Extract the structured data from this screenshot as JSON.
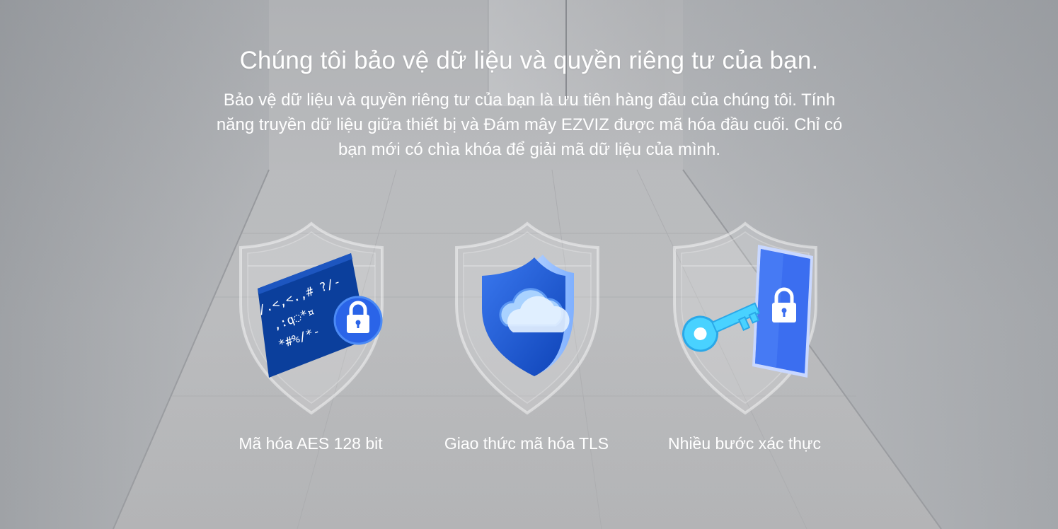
{
  "hero": {
    "title": "Chúng tôi bảo vệ dữ liệu và quyền riêng tư của bạn.",
    "description": "Bảo vệ dữ liệu và quyền riêng tư của bạn là ưu tiên hàng đầu của chúng tôi. Tính năng truyền dữ liệu giữa thiết bị và Đám mây EZVIZ được mã hóa đầu cuối. Chỉ có bạn mới có chìa khóa để giải mã dữ liệu của mình."
  },
  "features": [
    {
      "label": "Mã hóa AES 128 bit",
      "icon": "encrypted-code-card-icon",
      "code_lines": [
        "/.<,<.,# ?/-",
        ",:q◌*¤",
        "*#%/*-"
      ]
    },
    {
      "label": "Giao thức mã hóa TLS",
      "icon": "cloud-shield-icon"
    },
    {
      "label": "Nhiều bước xác thực",
      "icon": "key-phone-lock-icon"
    }
  ],
  "colors": {
    "text": "#ffffff",
    "navy": "#0b3f9c",
    "blue": "#2a64e8",
    "light_blue": "#8ec9ff",
    "cyan": "#49d2ff"
  }
}
